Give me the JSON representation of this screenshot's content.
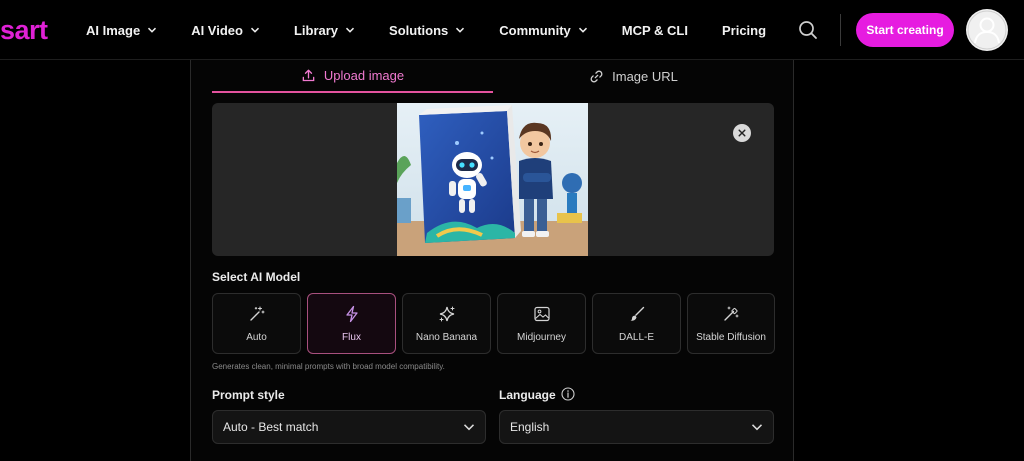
{
  "brand": {
    "logo_text": "sart",
    "accent": "#e61ce0"
  },
  "nav": {
    "items": [
      {
        "label": "AI Image",
        "dropdown": true
      },
      {
        "label": "AI Video",
        "dropdown": true
      },
      {
        "label": "Library",
        "dropdown": true
      },
      {
        "label": "Solutions",
        "dropdown": true
      },
      {
        "label": "Community",
        "dropdown": true
      },
      {
        "label": "MCP & CLI",
        "dropdown": false
      },
      {
        "label": "Pricing",
        "dropdown": false
      }
    ],
    "search_icon": "search-icon",
    "start_label": "Start creating",
    "avatar_icon": "user-icon"
  },
  "tabs": [
    {
      "label": "Upload image",
      "icon": "upload-icon",
      "active": true
    },
    {
      "label": "Image URL",
      "icon": "link-icon",
      "active": false
    }
  ],
  "preview": {
    "close_icon": "close-icon"
  },
  "model_section": {
    "label": "Select AI Model",
    "models": [
      {
        "label": "Auto",
        "icon": "magic-wand-icon",
        "active": false
      },
      {
        "label": "Flux",
        "icon": "lightning-icon",
        "active": true
      },
      {
        "label": "Nano Banana",
        "icon": "sparkle-icon",
        "active": false
      },
      {
        "label": "Midjourney",
        "icon": "image-icon",
        "active": false
      },
      {
        "label": "DALL-E",
        "icon": "brush-icon",
        "active": false
      },
      {
        "label": "Stable Diffusion",
        "icon": "wand-sparkle-icon",
        "active": false
      }
    ],
    "hint": "Generates clean, minimal prompts with broad model compatibility."
  },
  "prompt_style": {
    "label": "Prompt style",
    "value": "Auto - Best match"
  },
  "language": {
    "label": "Language",
    "value": "English",
    "info_icon": "info-icon"
  }
}
